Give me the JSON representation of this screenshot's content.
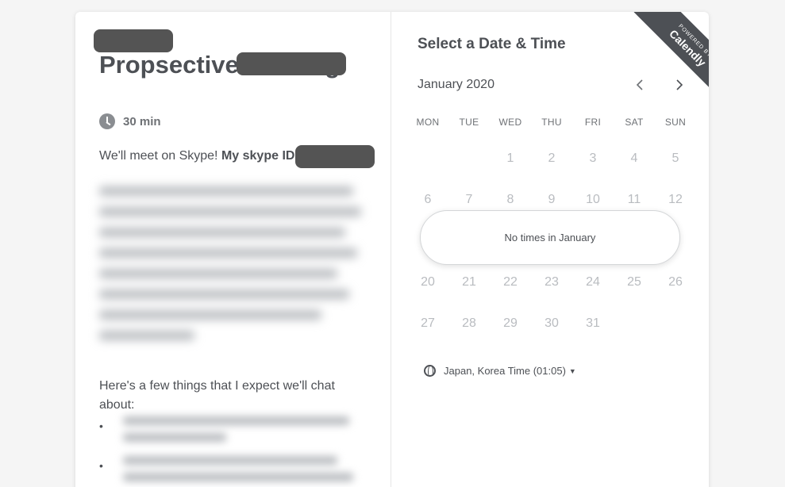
{
  "event": {
    "title": "Propsective meeting",
    "duration": "30 min",
    "location_prefix": "We'll meet on Skype!",
    "location_label": "My skype ID:",
    "expect_text": "Here's a few things that I expect we'll chat about:",
    "bullets": [
      "•",
      "•"
    ]
  },
  "calendar": {
    "heading": "Select a Date & Time",
    "month": "January 2020",
    "prev_icon": "chevron-left-icon",
    "next_icon": "chevron-right-icon",
    "weekdays": [
      "MON",
      "TUE",
      "WED",
      "THU",
      "FRI",
      "SAT",
      "SUN"
    ],
    "weeks": [
      [
        "",
        "",
        "1",
        "2",
        "3",
        "4",
        "5"
      ],
      [
        "6",
        "7",
        "8",
        "9",
        "10",
        "11",
        "12"
      ],
      [
        "20",
        "21",
        "22",
        "23",
        "24",
        "25",
        "26"
      ],
      [
        "27",
        "28",
        "29",
        "30",
        "31",
        "",
        ""
      ]
    ],
    "no_times": "No times in January",
    "timezone": "Japan, Korea Time (01:05)",
    "timezone_icon": "globe-icon"
  },
  "branding": {
    "powered_by": "POWERED BY",
    "brand": "Calendly"
  },
  "colors": {
    "text": "#4d5055",
    "muted_day": "#b9bcc0",
    "ribbon": "#4d5055",
    "redaction": "#545454"
  }
}
